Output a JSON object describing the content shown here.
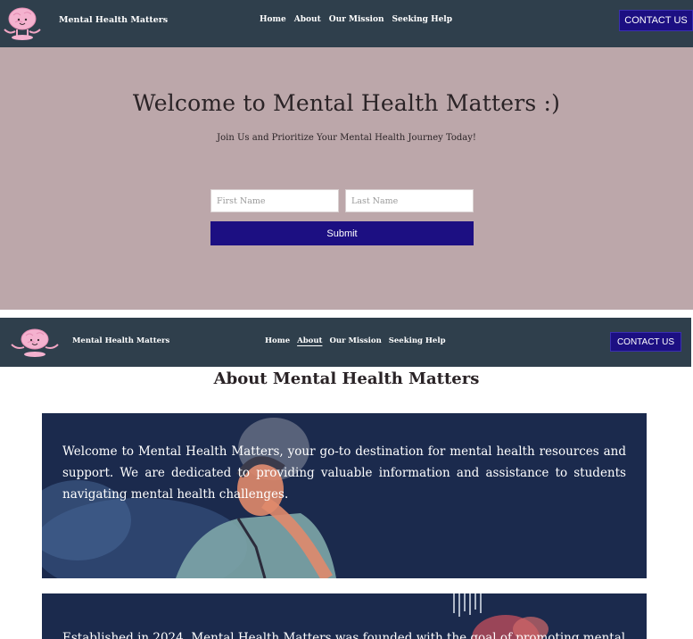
{
  "site": {
    "name": "Mental Health Matters",
    "logo_icon": "brain-mascot-icon",
    "brand_color": "#1c0f82",
    "header_color": "#2f3f4c"
  },
  "nav": {
    "items": [
      {
        "label": "Home"
      },
      {
        "label": "About"
      },
      {
        "label": "Our Mission"
      },
      {
        "label": "Seeking Help"
      }
    ],
    "contact_label": "CONTACT US"
  },
  "hero": {
    "title": "Welcome to Mental Health Matters :)",
    "subtitle": "Join Us and Prioritize Your Mental Health Journey Today!",
    "first_name_placeholder": "First Name",
    "last_name_placeholder": "Last Name",
    "submit_label": "Submit",
    "background_color": "#bca7aa"
  },
  "about": {
    "active_nav": "About",
    "title": "About Mental Health Matters",
    "card_color": "#1b2a4d",
    "cards": [
      {
        "text": "Welcome to Mental Health Matters, your go-to destination for mental health resources and support. We are dedicated to providing valuable information and assistance to students navigating mental health challenges."
      },
      {
        "text": "Established in 2024, Mental Health Matters was founded with the goal of promoting mental"
      }
    ]
  }
}
